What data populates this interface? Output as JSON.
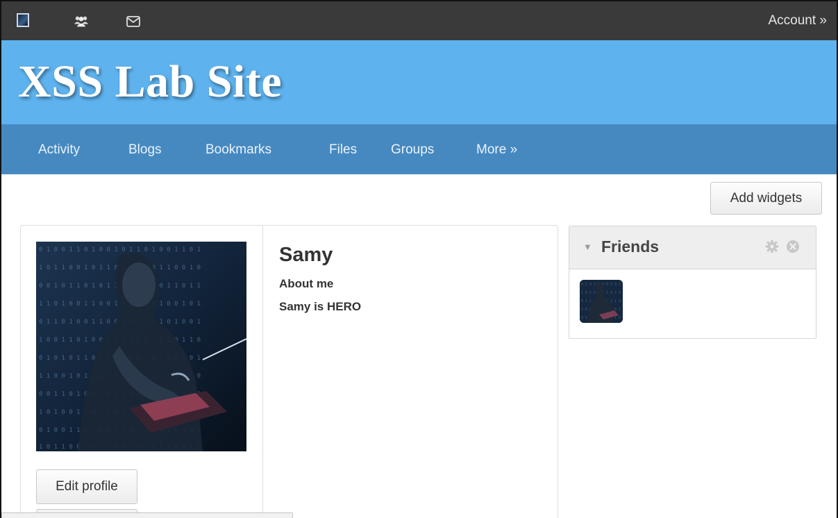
{
  "topbar": {
    "icons": [
      "site-logo-icon",
      "users-icon",
      "mail-icon"
    ],
    "account_label": "Account »"
  },
  "header": {
    "title": "XSS Lab Site",
    "background_color": "#5eb3ef"
  },
  "nav": {
    "background_color": "#4689c0",
    "items": [
      {
        "label": "Activity"
      },
      {
        "label": "Blogs"
      },
      {
        "label": "Bookmarks"
      },
      {
        "label": "Files"
      },
      {
        "label": "Groups"
      },
      {
        "label": "More »"
      }
    ]
  },
  "toolbar": {
    "add_widgets_label": "Add widgets"
  },
  "profile": {
    "name": "Samy",
    "about_label": "About me",
    "about_text": "Samy is HERO",
    "edit_profile_label": "Edit profile"
  },
  "friends_widget": {
    "title": "Friends",
    "icons": [
      "gear-icon",
      "close-icon"
    ]
  }
}
